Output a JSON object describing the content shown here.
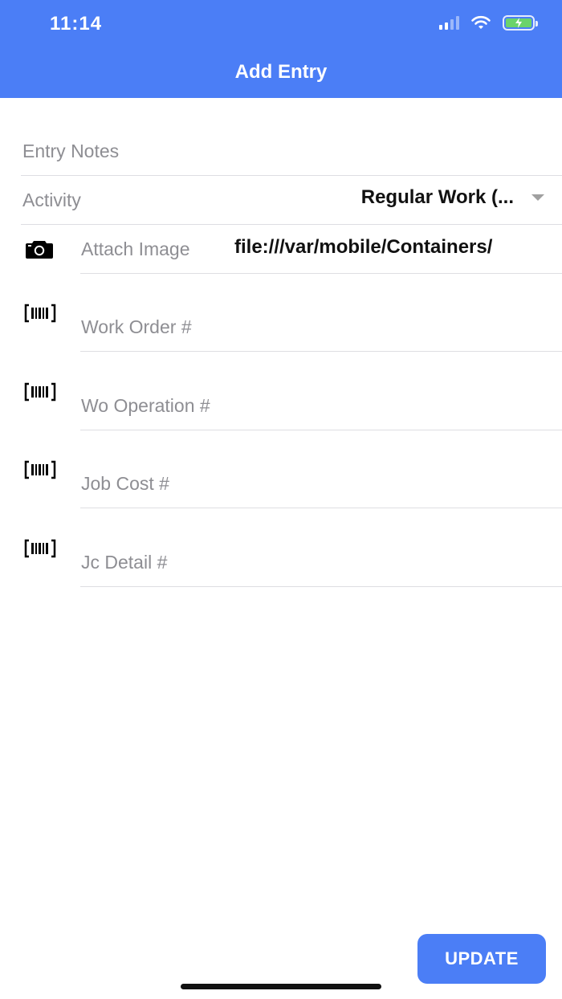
{
  "status_bar": {
    "time": "11:14",
    "signal_icon": "signal-bars-icon",
    "wifi_icon": "wifi-icon",
    "battery_icon": "battery-charging-icon"
  },
  "header": {
    "title": "Add Entry",
    "background_color": "#4b7ef6"
  },
  "form": {
    "entry_notes_placeholder": "Entry Notes",
    "activity_label": "Activity",
    "activity_value": "Regular Work (...",
    "attach_image_label": "Attach Image",
    "attach_image_value": "file:///var/mobile/Containers/",
    "camera_icon": "camera-icon",
    "barcode_icon": "barcode-scan-icon",
    "fields": [
      {
        "placeholder": "Work Order #"
      },
      {
        "placeholder": "Wo Operation #"
      },
      {
        "placeholder": "Job Cost #"
      },
      {
        "placeholder": "Jc Detail #"
      }
    ]
  },
  "actions": {
    "update_label": "UPDATE"
  }
}
